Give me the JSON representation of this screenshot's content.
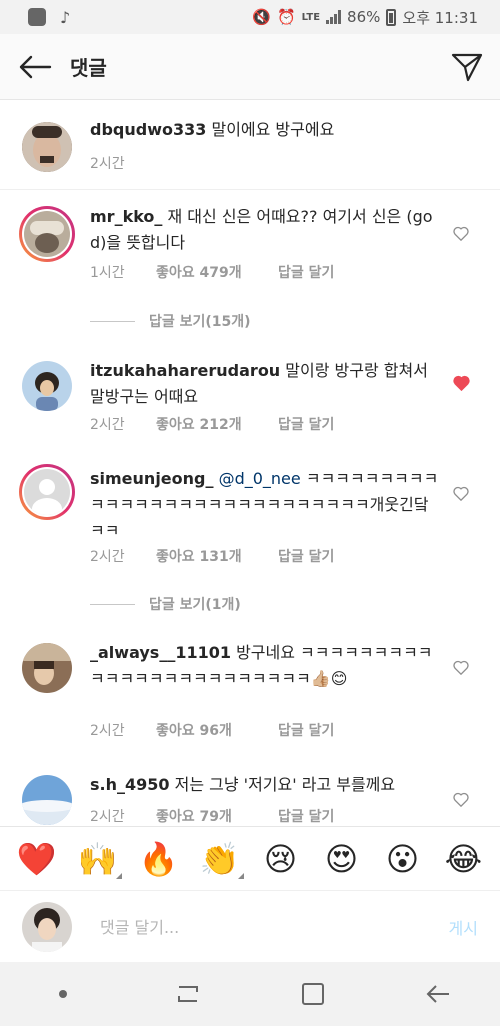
{
  "status_bar": {
    "network": "LTE",
    "battery": "86%",
    "time": "오후 11:31"
  },
  "header": {
    "title": "댓글"
  },
  "caption": {
    "username": "dbqudwo333",
    "text": "말이에요 방구에요",
    "time": "2시간"
  },
  "comments": [
    {
      "username": "mr_kko_",
      "text": "재 대신 신은 어때요?? 여기서 신은 (god)을 뜻합니다",
      "time": "1시간",
      "likes": "좋아요 479개",
      "reply": "답글 달기",
      "liked": false
    },
    {
      "username": "itzukahaharerudarou",
      "text": "말이랑 방구랑 합쳐서 말방구는 어때요",
      "time": "2시간",
      "likes": "좋아요 212개",
      "reply": "답글 달기",
      "liked": true
    },
    {
      "username": "simeunjeong_",
      "mention": "@d_0_nee",
      "text": "ㅋㅋㅋㅋㅋㅋㅋㅋㅋㅋㅋㅋㅋㅋㅋㅋㅋㅋㅋㅋㅋㅋㅋㅋㅋㅋㅋㅋ개웃긴닼ㅋㅋ",
      "time": "2시간",
      "likes": "좋아요 131개",
      "reply": "답글 달기",
      "liked": false
    },
    {
      "username": "_always__11101",
      "text": "방구네요 ㅋㅋㅋㅋㅋㅋㅋㅋㅋㅋㅋㅋㅋㅋㅋㅋㅋㅋㅋㅋㅋㅋㅋㅋ👍🏼😊",
      "time": "2시간",
      "likes": "좋아요 96개",
      "reply": "답글 달기",
      "liked": false
    },
    {
      "username": "s.h_4950",
      "text": "저는 그냥 '저기요' 라고 부를께요",
      "time": "2시간",
      "likes": "좋아요 79개",
      "reply": "답글 달기",
      "liked": false
    }
  ],
  "view_replies": [
    "답글 보기(15개)",
    "답글 보기(1개)"
  ],
  "emoji_bar": [
    "❤️",
    "🙌",
    "🔥",
    "👏",
    "😢",
    "😍",
    "😮",
    "😂"
  ],
  "input": {
    "placeholder": "댓글 달기...",
    "post_label": "게시"
  },
  "colors": {
    "liked_heart": "#ed4956",
    "post_button_disabled": "#b2dffc",
    "meta_gray": "#999999"
  }
}
